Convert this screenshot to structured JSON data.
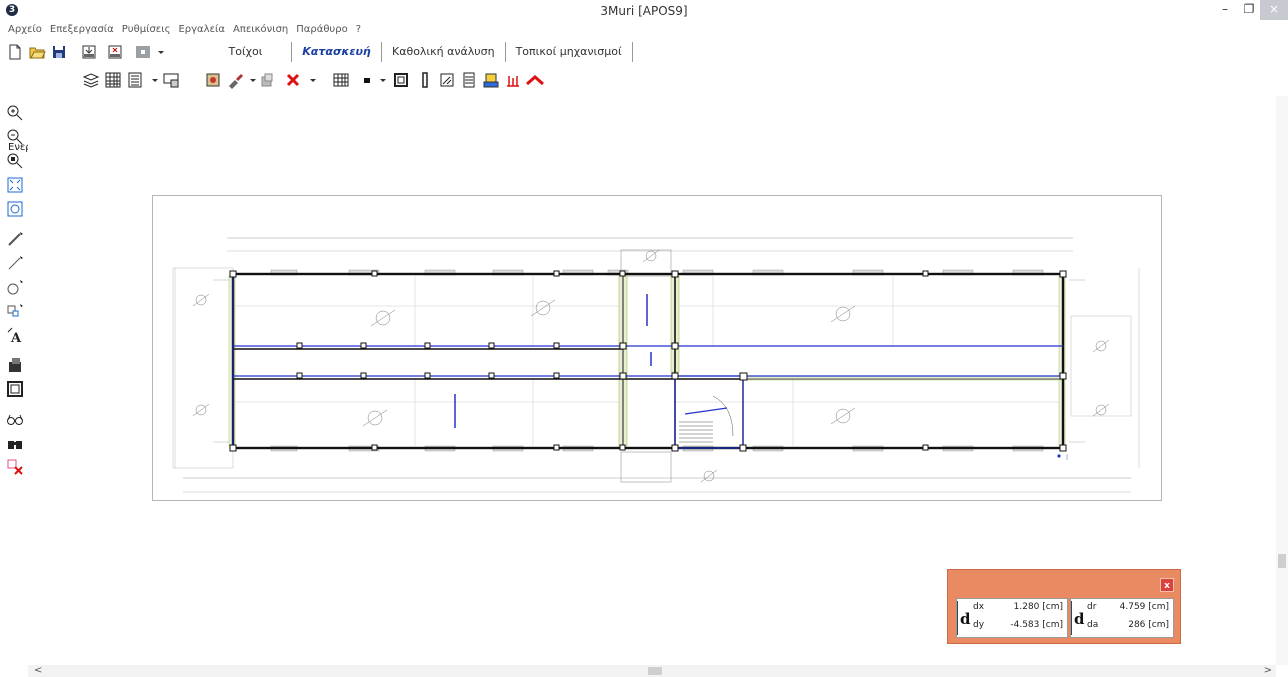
{
  "window": {
    "title": "3Muri  [APOS9]",
    "logo_glyph": "3",
    "min_glyph": "–",
    "max_glyph": "❐",
    "close_glyph": "×"
  },
  "menu": [
    "Αρχείο",
    "Επεξεργασία",
    "Ρυθμίσεις",
    "Εργαλεία",
    "Απεικόνιση",
    "Παράθυρο",
    "?"
  ],
  "tabs": [
    {
      "label": "Τοίχοι",
      "active": false
    },
    {
      "label": "Κατασκευή",
      "active": true
    },
    {
      "label": "Καθολική ανάλυση",
      "active": false
    },
    {
      "label": "Τοπικοί μηχανισμοί",
      "active": false
    }
  ],
  "toolbar2": {
    "active_level_label": "Ενεργή στάθμη"
  },
  "icons": {
    "toolbar1": [
      "new-file-icon",
      "open-folder-icon",
      "save-icon",
      "import-dxf-icon",
      "export-dxf-icon",
      "color-picker-icon"
    ],
    "toolbar2": [
      "levels-icon",
      "grid-table-icon",
      "list-icon",
      "level-view-icon",
      "wall-block-icon",
      "brush-icon",
      "copy-icon",
      "delete-icon",
      "hatch-icon",
      "point-icon",
      "frame-icon",
      "column-icon",
      "section-icon",
      "layers-icon",
      "floor-icon",
      "foundation-icon",
      "roof-icon"
    ],
    "lefttools": [
      "zoom-in-icon",
      "zoom-out-icon",
      "zoom-window-icon",
      "zoom-extents-icon",
      "zoom-refresh-icon",
      "draw-line-icon",
      "polyline-icon",
      "circle-icon",
      "rectangle-icon",
      "text-icon",
      "fill-icon",
      "frame-icon",
      "glasses-icon",
      "binoculars-icon",
      "delete-selection-icon"
    ]
  },
  "readout": {
    "close_label": "x",
    "left_symbol": "d",
    "right_symbol": "d",
    "dx_key": "dx",
    "dx_value": "1.280 [cm]",
    "dy_key": "dy",
    "dy_value": "-4.583 [cm]",
    "dr_key": "dr",
    "dr_value": "4.759 [cm]",
    "da_key": "da",
    "da_value": "286 [cm]"
  },
  "scroll": {
    "left_arrow": "<",
    "right_arrow": ">"
  },
  "colors": {
    "readout_bg": "#e98a63",
    "close_red": "#d9433a",
    "active_tab": "#1a3fa0",
    "wall_black": "#111111",
    "beam_blue": "#2233cc",
    "pier_green": "#9fbf60"
  }
}
